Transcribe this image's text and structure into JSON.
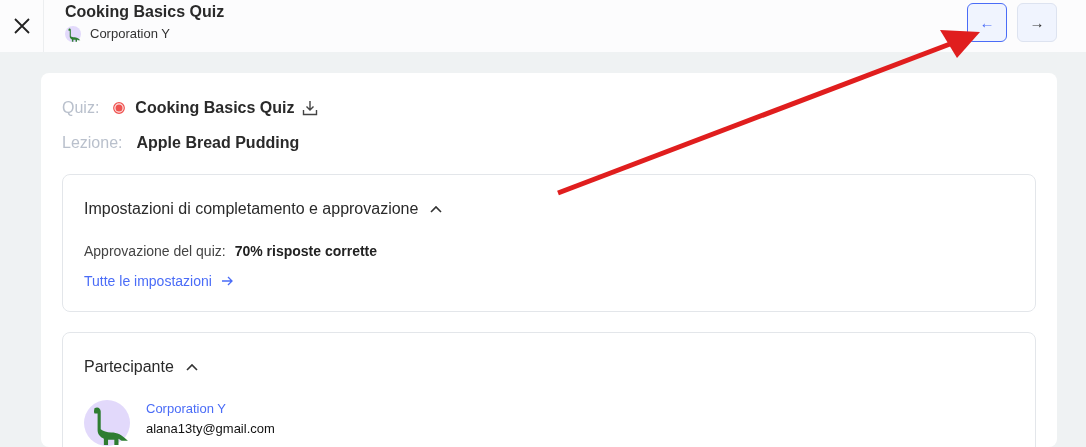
{
  "header": {
    "title": "Cooking Basics Quiz",
    "organization": "Corporation Y",
    "nav_buttons": [
      {
        "symbol": "←",
        "active": true
      },
      {
        "symbol": "→",
        "active": false
      }
    ]
  },
  "quiz": {
    "label": "Quiz:",
    "value": "Cooking Basics Quiz"
  },
  "lesson": {
    "label": "Lezione:",
    "value": "Apple Bread Pudding"
  },
  "sections": [
    {
      "kind": "settings",
      "title": "Impostazioni di completamento e approvazione",
      "expanded": true,
      "field_label": "Approvazione del quiz:",
      "field_value": "70% risposte corrette",
      "link": "Tutte le impostazioni"
    },
    {
      "kind": "participant",
      "title": "Partecipante",
      "expanded": true,
      "name": "Corporation Y",
      "email": "alana13ty@gmail.com"
    }
  ],
  "annotation": {
    "kind": "arrow"
  }
}
